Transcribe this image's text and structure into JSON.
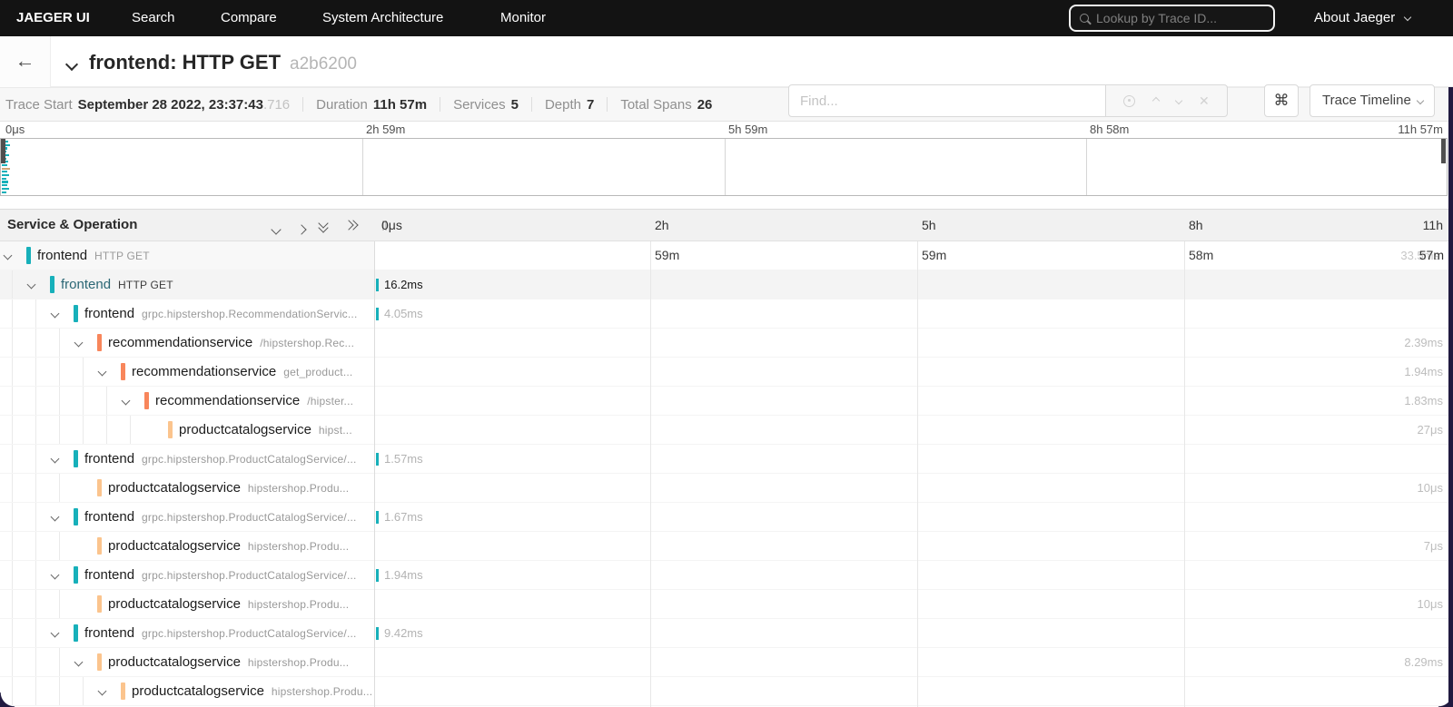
{
  "colors": {
    "teal": "#17b0ba",
    "orange": "#f8865b",
    "peach": "#fbc48d",
    "tan": "#cfa678",
    "selected_text": "#2b6775",
    "nav_bg": "#131313"
  },
  "nav": {
    "brand": "JAEGER UI",
    "items": [
      {
        "label": "Search"
      },
      {
        "label": "Compare"
      },
      {
        "label": "System Architecture"
      },
      {
        "label": "Monitor"
      }
    ],
    "lookup_placeholder": "Lookup by Trace ID...",
    "about_label": "About Jaeger"
  },
  "trace_header": {
    "title": "frontend: HTTP GET",
    "trace_id_short": "a2b6200",
    "find_placeholder": "Find...",
    "shortcut_key": "⌘",
    "view_select_label": "Trace Timeline"
  },
  "stats": {
    "trace_start_label": "Trace Start",
    "trace_start_value": "September 28 2022, 23:37:43",
    "trace_start_ms": ".716",
    "duration_label": "Duration",
    "duration_value": "11h 57m",
    "services_label": "Services",
    "services_value": "5",
    "depth_label": "Depth",
    "depth_value": "7",
    "total_spans_label": "Total Spans",
    "total_spans_value": "26"
  },
  "minimap": {
    "ruler_ticks": [
      "0μs",
      "2h 59m",
      "5h 59m",
      "8h 58m",
      "11h 57m"
    ],
    "span_ticks": [
      {
        "w": 7,
        "c": "teal"
      },
      {
        "w": 9,
        "c": "teal"
      },
      {
        "w": 6,
        "c": "teal"
      },
      {
        "w": 5,
        "c": "teal"
      },
      {
        "w": 8,
        "c": "teal"
      },
      {
        "w": 5,
        "c": "teal"
      },
      {
        "w": 7,
        "c": "teal"
      },
      {
        "w": 6,
        "c": "teal"
      },
      {
        "w": 9,
        "c": "tan"
      },
      {
        "w": 6,
        "c": "teal"
      },
      {
        "w": 8,
        "c": "teal"
      },
      {
        "w": 5,
        "c": "teal"
      },
      {
        "w": 7,
        "c": "teal"
      },
      {
        "w": 6,
        "c": "teal"
      },
      {
        "w": 8,
        "c": "teal"
      },
      {
        "w": 5,
        "c": "teal"
      }
    ]
  },
  "timeline": {
    "left_header": "Service & Operation",
    "ticks_top": [
      "0μs",
      "2h",
      "5h",
      "8h",
      "11h"
    ],
    "ticks_sub": [
      "59m",
      "59m",
      "58m",
      "57m"
    ],
    "root_ghost_duration": "33.5ms"
  },
  "spans": [
    {
      "depth": 0,
      "service": "frontend",
      "operation": "HTTP GET",
      "color": "teal",
      "children": true,
      "root": true
    },
    {
      "depth": 1,
      "service": "frontend",
      "operation": "HTTP GET",
      "color": "teal",
      "children": true,
      "selected": true,
      "bar_label": "16.2ms"
    },
    {
      "depth": 2,
      "service": "frontend",
      "operation": "grpc.hipstershop.RecommendationServic...",
      "color": "teal",
      "children": true,
      "bar_label": "4.05ms"
    },
    {
      "depth": 3,
      "service": "recommendationservice",
      "operation": "/hipstershop.Rec...",
      "color": "orange",
      "children": true,
      "right_label": "2.39ms"
    },
    {
      "depth": 4,
      "service": "recommendationservice",
      "operation": "get_product...",
      "color": "orange",
      "children": true,
      "right_label": "1.94ms"
    },
    {
      "depth": 5,
      "service": "recommendationservice",
      "operation": "/hipster...",
      "color": "orange",
      "children": true,
      "right_label": "1.83ms"
    },
    {
      "depth": 6,
      "service": "productcatalogservice",
      "operation": "hipst...",
      "color": "peach",
      "children": false,
      "right_label": "27μs"
    },
    {
      "depth": 2,
      "service": "frontend",
      "operation": "grpc.hipstershop.ProductCatalogService/...",
      "color": "teal",
      "children": true,
      "bar_label": "1.57ms"
    },
    {
      "depth": 3,
      "service": "productcatalogservice",
      "operation": "hipstershop.Produ...",
      "color": "peach",
      "children": false,
      "right_label": "10μs"
    },
    {
      "depth": 2,
      "service": "frontend",
      "operation": "grpc.hipstershop.ProductCatalogService/...",
      "color": "teal",
      "children": true,
      "bar_label": "1.67ms"
    },
    {
      "depth": 3,
      "service": "productcatalogservice",
      "operation": "hipstershop.Produ...",
      "color": "peach",
      "children": false,
      "right_label": "7μs"
    },
    {
      "depth": 2,
      "service": "frontend",
      "operation": "grpc.hipstershop.ProductCatalogService/...",
      "color": "teal",
      "children": true,
      "bar_label": "1.94ms"
    },
    {
      "depth": 3,
      "service": "productcatalogservice",
      "operation": "hipstershop.Produ...",
      "color": "peach",
      "children": false,
      "right_label": "10μs"
    },
    {
      "depth": 2,
      "service": "frontend",
      "operation": "grpc.hipstershop.ProductCatalogService/...",
      "color": "teal",
      "children": true,
      "bar_label": "9.42ms"
    },
    {
      "depth": 3,
      "service": "productcatalogservice",
      "operation": "hipstershop.Produ...",
      "color": "peach",
      "children": true,
      "right_label": "8.29ms"
    },
    {
      "depth": 4,
      "service": "productcatalogservice",
      "operation": "hipstershop.Produ...",
      "color": "peach",
      "children": true,
      "right_label": ""
    }
  ]
}
